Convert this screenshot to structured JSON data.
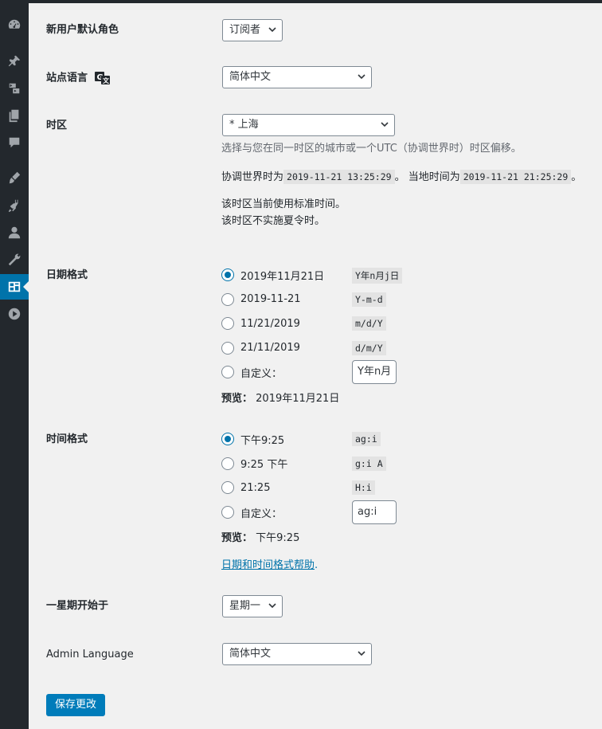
{
  "settings": {
    "default_role": {
      "label": "新用户默认角色",
      "value": "订阅者"
    },
    "site_language": {
      "label": "站点语言",
      "value": "简体中文"
    },
    "timezone": {
      "label": "时区",
      "value": "* 上海",
      "help": "选择与您在同一时区的城市或一个UTC（协调世界时）时区偏移。",
      "utc_prefix": "协调世界时为",
      "utc_time": "2019-11-21 13:25:29",
      "local_prefix": "。 当地时间为",
      "local_time": "2019-11-21 21:25:29",
      "local_suffix": "。",
      "std_note": "该时区当前使用标准时间。",
      "dst_note": "该时区不实施夏令时。"
    },
    "date_format": {
      "label": "日期格式",
      "options": [
        {
          "text": "2019年11月21日",
          "code": "Y年n月j日",
          "checked": true
        },
        {
          "text": "2019-11-21",
          "code": "Y-m-d",
          "checked": false
        },
        {
          "text": "11/21/2019",
          "code": "m/d/Y",
          "checked": false
        },
        {
          "text": "21/11/2019",
          "code": "d/m/Y",
          "checked": false
        }
      ],
      "custom_label": "自定义：",
      "custom_value": "Y年n月",
      "preview_label": "预览：",
      "preview_value": "2019年11月21日"
    },
    "time_format": {
      "label": "时间格式",
      "options": [
        {
          "text": "下午9:25",
          "code": "ag:i",
          "checked": true
        },
        {
          "text": "9:25 下午",
          "code": "g:i A",
          "checked": false
        },
        {
          "text": "21:25",
          "code": "H:i",
          "checked": false
        }
      ],
      "custom_label": "自定义：",
      "custom_value": "ag:i",
      "preview_label": "预览：",
      "preview_value": "下午9:25",
      "help_link": "日期和时间格式帮助",
      "help_suffix": "."
    },
    "week_start": {
      "label": "一星期开始于",
      "value": "星期一"
    },
    "admin_language": {
      "label": "Admin Language",
      "value": "简体中文"
    },
    "save_button": "保存更改"
  },
  "sidebar": {
    "icons": [
      "dashboard-icon",
      "pin-icon",
      "media-icon",
      "pages-icon",
      "comments-icon",
      "appearance-icon",
      "plugins-icon",
      "users-icon",
      "tools-icon",
      "settings-icon",
      "play-icon"
    ],
    "active": "settings-icon"
  },
  "colors": {
    "accent": "#0073aa",
    "button": "#007cba",
    "sidebar": "#23282d",
    "background": "#f1f1f1"
  }
}
